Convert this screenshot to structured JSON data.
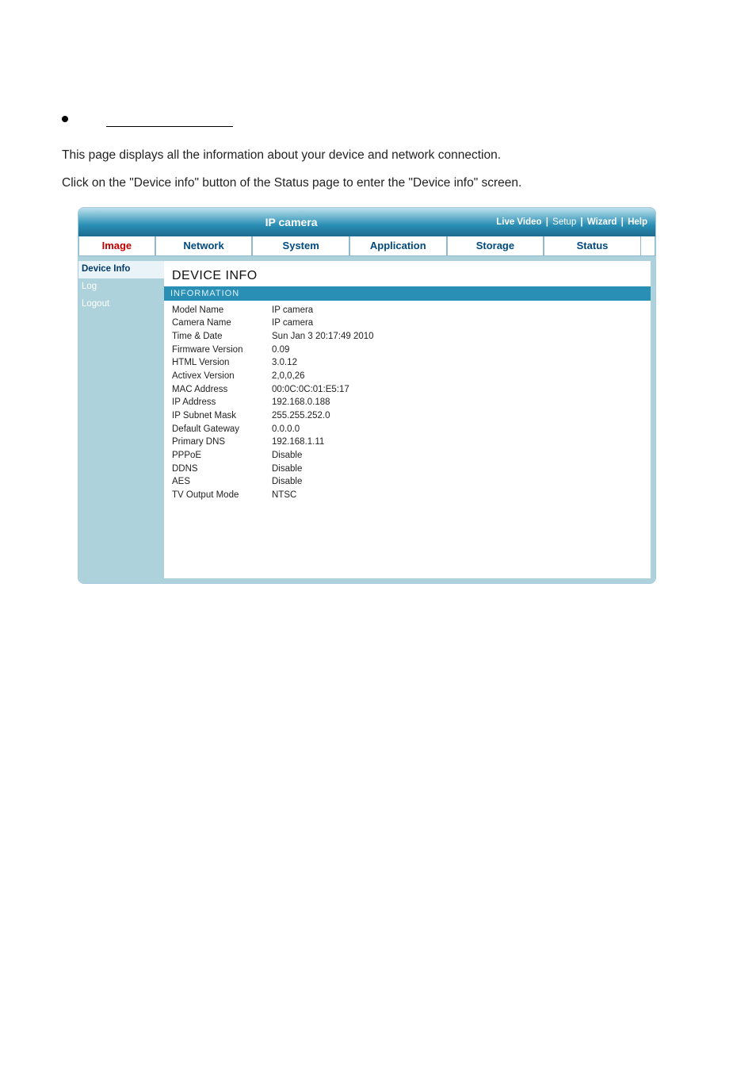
{
  "intro": {
    "line1": "This page displays all the information about your device and network connection.",
    "line2": "Click on the \"Device info\" button of the Status page to enter the \"Device info\" screen."
  },
  "header": {
    "title": "IP camera",
    "links": {
      "live_video": "Live Video",
      "setup": "Setup",
      "wizard": "Wizard",
      "help": "Help"
    }
  },
  "tabs": {
    "image": "Image",
    "network": "Network",
    "system": "System",
    "application": "Application",
    "storage": "Storage",
    "status": "Status"
  },
  "sidebar": {
    "device_info": "Device Info",
    "log": "Log",
    "logout": "Logout"
  },
  "main": {
    "title": "DEVICE INFO",
    "section": "INFORMATION",
    "rows": [
      {
        "label": "Model Name",
        "value": "IP camera"
      },
      {
        "label": "Camera Name",
        "value": "IP camera"
      },
      {
        "label": "Time & Date",
        "value": "Sun Jan 3 20:17:49 2010"
      },
      {
        "label": "Firmware Version",
        "value": "0.09"
      },
      {
        "label": "HTML Version",
        "value": "3.0.12"
      },
      {
        "label": "Activex Version",
        "value": "2,0,0,26"
      },
      {
        "label": "MAC Address",
        "value": "00:0C:0C:01:E5:17"
      },
      {
        "label": "IP Address",
        "value": "192.168.0.188"
      },
      {
        "label": "IP Subnet Mask",
        "value": "255.255.252.0"
      },
      {
        "label": "Default Gateway",
        "value": "0.0.0.0"
      },
      {
        "label": "Primary DNS",
        "value": "192.168.1.11"
      },
      {
        "label": "PPPoE",
        "value": "Disable"
      },
      {
        "label": "DDNS",
        "value": "Disable"
      },
      {
        "label": "AES",
        "value": "Disable"
      },
      {
        "label": "TV Output Mode",
        "value": "NTSC"
      }
    ]
  }
}
